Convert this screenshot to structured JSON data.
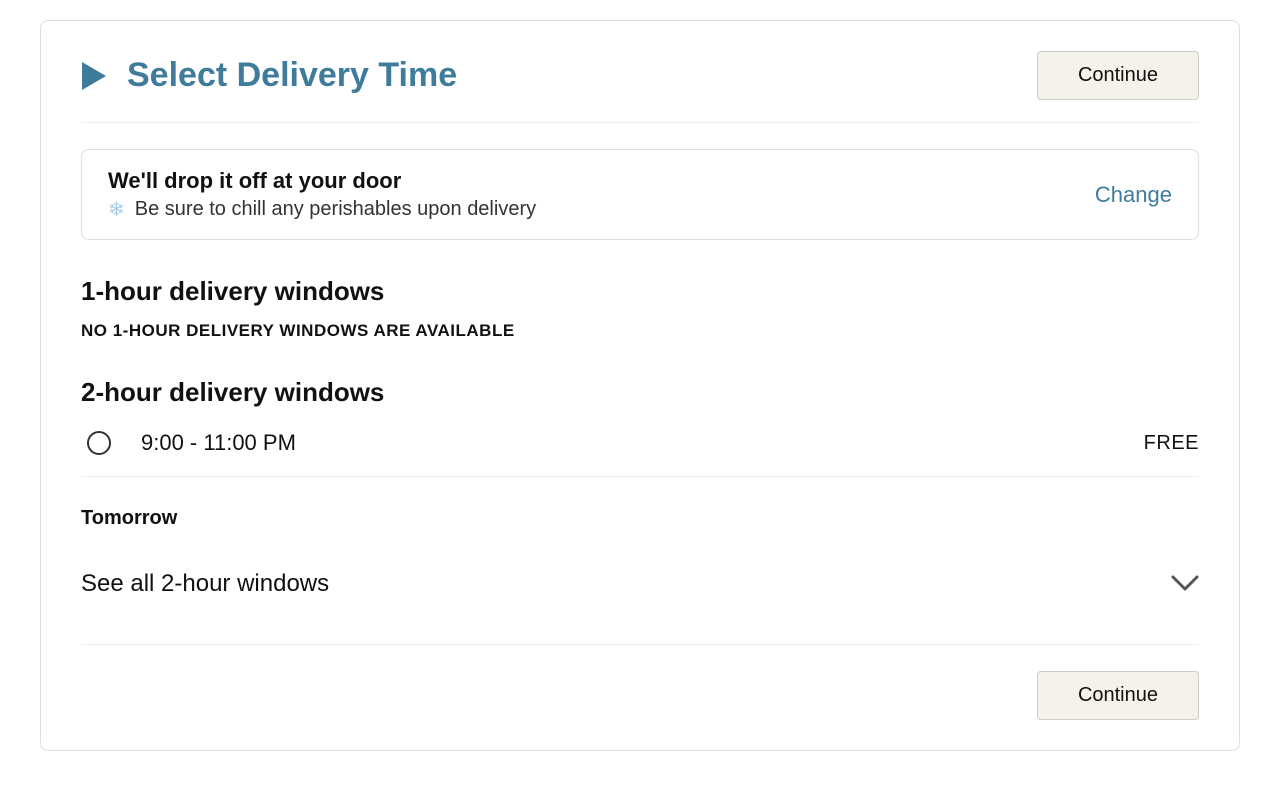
{
  "header": {
    "title": "Select Delivery Time",
    "continue_label": "Continue"
  },
  "dropoff": {
    "title": "We'll drop it off at your door",
    "subtitle": "Be sure to chill any perishables upon delivery",
    "change_label": "Change"
  },
  "one_hour": {
    "heading": "1-hour delivery windows",
    "none_msg": "NO 1-HOUR DELIVERY WINDOWS ARE AVAILABLE"
  },
  "two_hour": {
    "heading": "2-hour delivery windows",
    "slots": [
      {
        "time": "9:00 - 11:00 PM",
        "price": "FREE"
      }
    ]
  },
  "tomorrow": {
    "label": "Tomorrow",
    "see_all_label": "See all 2-hour windows"
  },
  "footer": {
    "continue_label": "Continue"
  }
}
